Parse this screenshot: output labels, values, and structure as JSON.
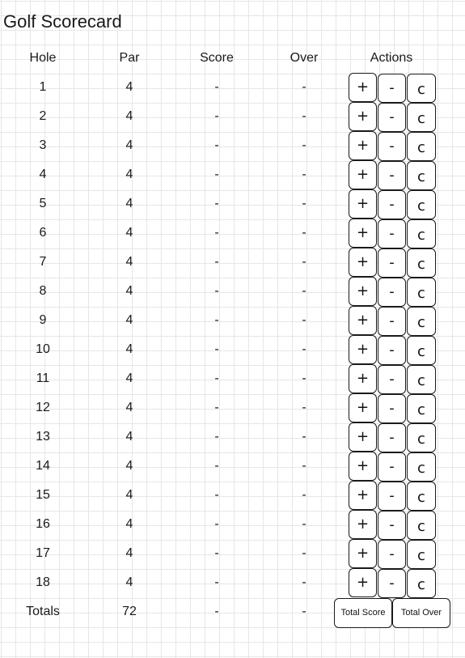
{
  "page": {
    "title": "Golf Scorecard"
  },
  "table": {
    "headers": {
      "hole": "Hole",
      "par": "Par",
      "score": "Score",
      "over": "Over",
      "actions": "Actions"
    },
    "rows": [
      {
        "hole": "1",
        "par": "4",
        "score": "-",
        "over": "-"
      },
      {
        "hole": "2",
        "par": "4",
        "score": "-",
        "over": "-"
      },
      {
        "hole": "3",
        "par": "4",
        "score": "-",
        "over": "-"
      },
      {
        "hole": "4",
        "par": "4",
        "score": "-",
        "over": "-"
      },
      {
        "hole": "5",
        "par": "4",
        "score": "-",
        "over": "-"
      },
      {
        "hole": "6",
        "par": "4",
        "score": "-",
        "over": "-"
      },
      {
        "hole": "7",
        "par": "4",
        "score": "-",
        "over": "-"
      },
      {
        "hole": "8",
        "par": "4",
        "score": "-",
        "over": "-"
      },
      {
        "hole": "9",
        "par": "4",
        "score": "-",
        "over": "-"
      },
      {
        "hole": "10",
        "par": "4",
        "score": "-",
        "over": "-"
      },
      {
        "hole": "11",
        "par": "4",
        "score": "-",
        "over": "-"
      },
      {
        "hole": "12",
        "par": "4",
        "score": "-",
        "over": "-"
      },
      {
        "hole": "13",
        "par": "4",
        "score": "-",
        "over": "-"
      },
      {
        "hole": "14",
        "par": "4",
        "score": "-",
        "over": "-"
      },
      {
        "hole": "15",
        "par": "4",
        "score": "-",
        "over": "-"
      },
      {
        "hole": "16",
        "par": "4",
        "score": "-",
        "over": "-"
      },
      {
        "hole": "17",
        "par": "4",
        "score": "-",
        "over": "-"
      },
      {
        "hole": "18",
        "par": "4",
        "score": "-",
        "over": "-"
      }
    ],
    "action_labels": {
      "plus": "+",
      "minus": "-",
      "clear": "c"
    },
    "totals": {
      "label": "Totals",
      "par": "72",
      "score": "-",
      "over": "-",
      "total_score_button": "Total Score",
      "total_over_button": "Total Over"
    }
  }
}
